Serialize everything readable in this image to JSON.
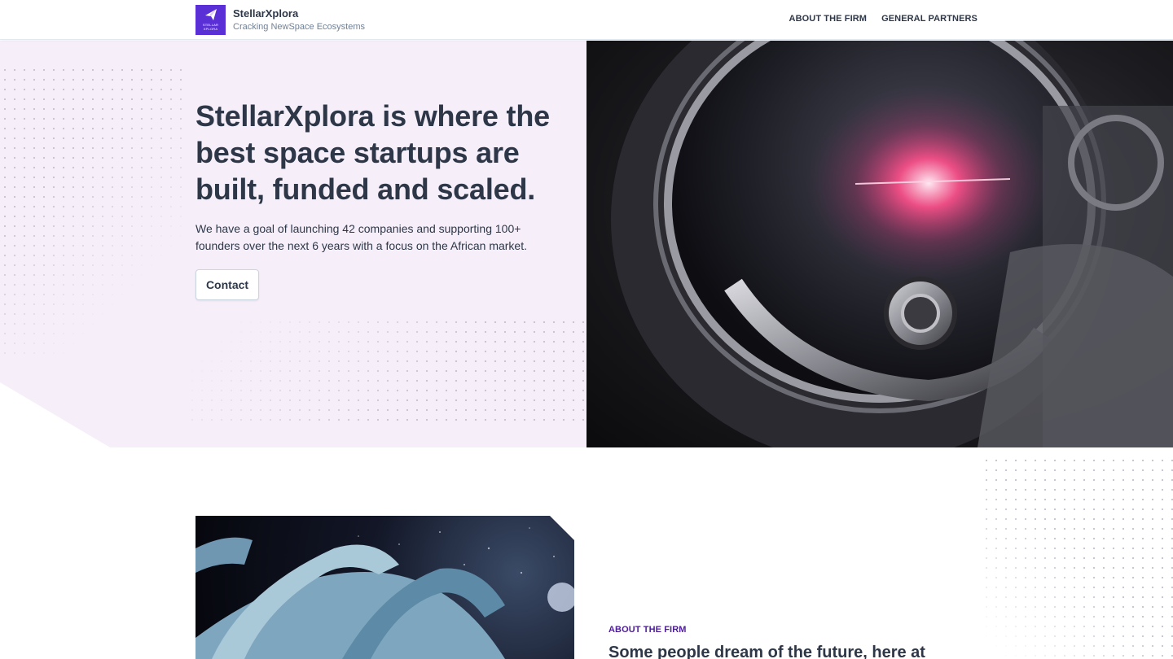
{
  "header": {
    "brand_name": "StellarXplora",
    "tagline": "Cracking NewSpace Ecosystems",
    "logo_text_line1": "STELLAR",
    "logo_text_line2": "XPLORA",
    "logo_icon": "paper-plane-icon",
    "nav": [
      {
        "label": "ABOUT THE FIRM"
      },
      {
        "label": "GENERAL PARTNERS"
      }
    ]
  },
  "hero": {
    "title": "StellarXplora is where the best space startups are built, funded and scaled.",
    "subtitle": "We have a goal of launching 42 companies and supporting 100+ founders over the next 6 years with a focus on the African market.",
    "contact_label": "Contact"
  },
  "about": {
    "label": "ABOUT THE FIRM",
    "heading": "Some people dream of the future, here at"
  },
  "colors": {
    "brand": "#5b2fd6",
    "hero_bg": "#f6eff9",
    "text": "#2d3748",
    "accent_label": "#4c1d95"
  }
}
